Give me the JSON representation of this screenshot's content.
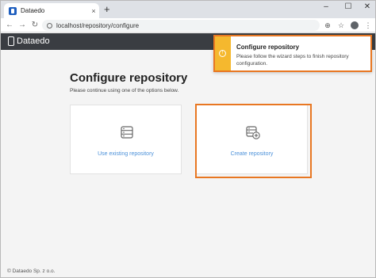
{
  "browser": {
    "tab_title": "Dataedo",
    "tab_close": "×",
    "new_tab": "+",
    "url": "localhost/repository/configure",
    "window_controls": [
      "–",
      "☐",
      "✕"
    ]
  },
  "app": {
    "logo_text": "Dataedo"
  },
  "main": {
    "title": "Configure repository",
    "subtitle": "Please continue using one of the options below.",
    "options": [
      {
        "label": "Use existing repository",
        "icon": "database-list-icon"
      },
      {
        "label": "Create repository",
        "icon": "database-add-icon"
      }
    ]
  },
  "footer": {
    "copyright": "© Dataedo Sp. z o.o."
  },
  "toast": {
    "title": "Configure repository",
    "message": "Please follow the wizard steps to finish repository configuration.",
    "icon": "warning-icon",
    "accent_color": "#f5b82e",
    "highlight_color": "#e87722"
  }
}
